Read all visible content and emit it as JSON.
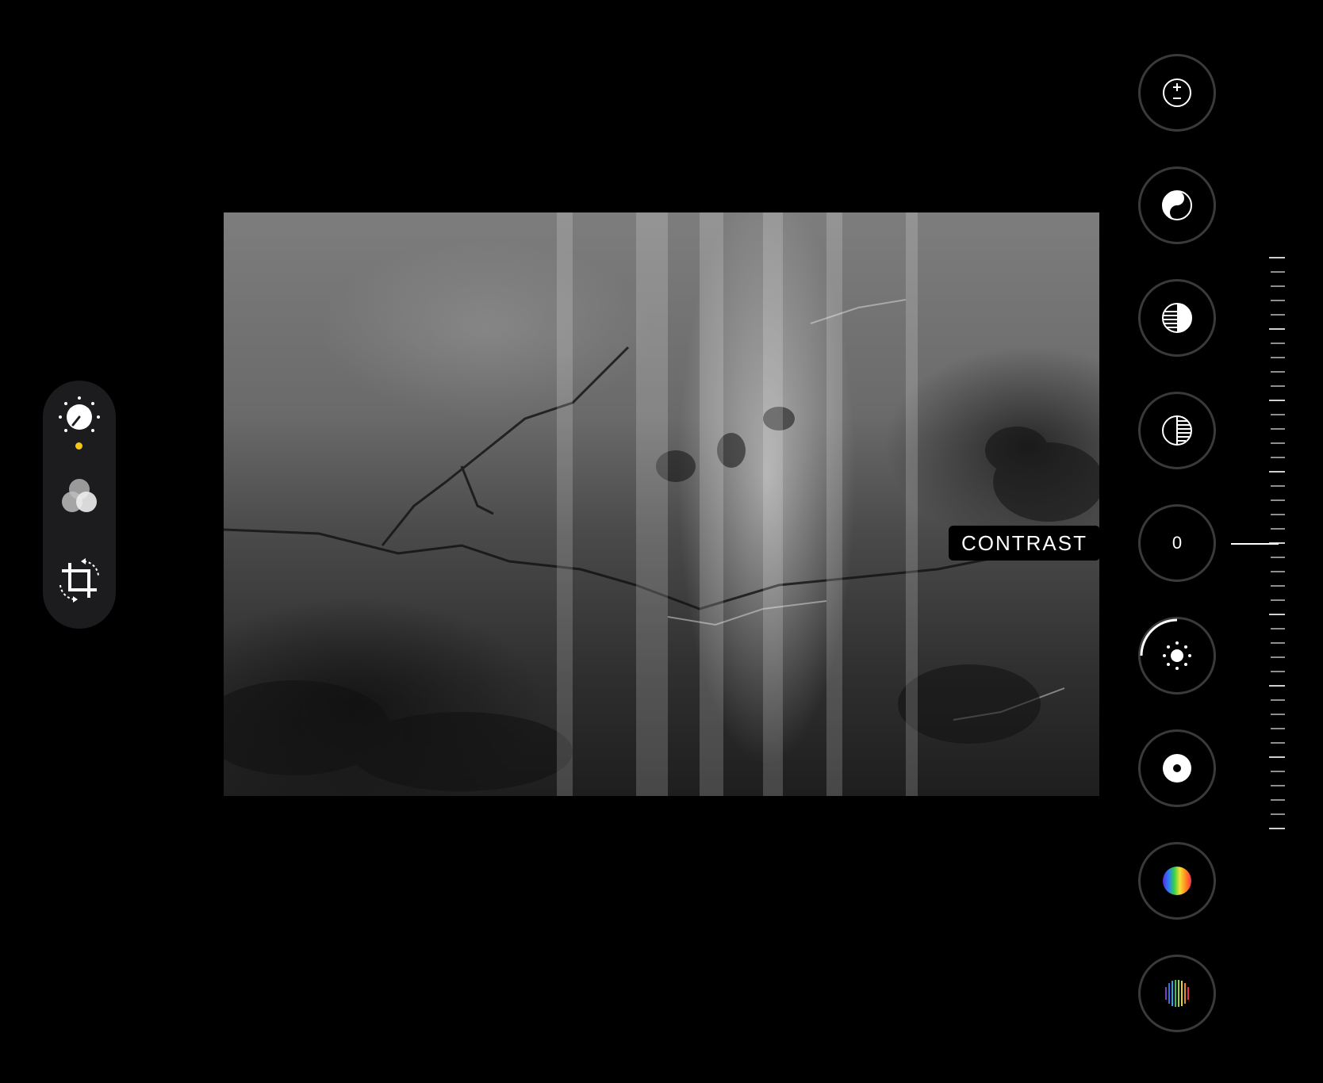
{
  "left_toolbar": {
    "items": [
      {
        "name": "adjust",
        "icon": "adjust-dial-icon",
        "active": true
      },
      {
        "name": "filters",
        "icon": "filters-circles-icon",
        "active": false
      },
      {
        "name": "crop",
        "icon": "crop-rotate-icon",
        "active": false
      }
    ],
    "active_color": "#f5c518"
  },
  "photo": {
    "description_icon": "photo-icon"
  },
  "adjustment": {
    "label": "CONTRAST",
    "value": "0"
  },
  "tools": [
    {
      "name": "exposure",
      "icon": "exposure-plus-minus-icon"
    },
    {
      "name": "brilliance",
      "icon": "yin-yang-icon"
    },
    {
      "name": "highlights",
      "icon": "highlights-icon"
    },
    {
      "name": "shadows",
      "icon": "shadows-icon"
    },
    {
      "name": "contrast",
      "icon": "contrast-value",
      "selected": true
    },
    {
      "name": "brightness",
      "icon": "sun-icon"
    },
    {
      "name": "black-point",
      "icon": "black-point-icon"
    },
    {
      "name": "saturation",
      "icon": "color-wheel-icon"
    },
    {
      "name": "vibrance",
      "icon": "vibrance-icon"
    }
  ]
}
